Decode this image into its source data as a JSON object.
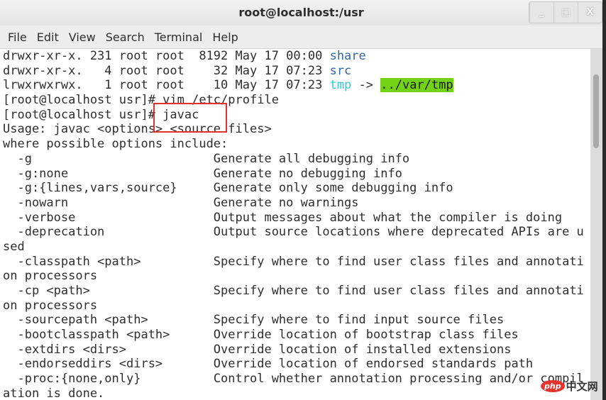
{
  "window": {
    "title": "root@localhost:/usr",
    "controls": [
      "minimize",
      "maximize",
      "close"
    ]
  },
  "menubar": [
    "File",
    "Edit",
    "View",
    "Search",
    "Terminal",
    "Help"
  ],
  "lines": [
    [
      {
        "t": "drwxr-xr-x. 231 root root  8192 May 17 00:00 "
      },
      {
        "t": "share",
        "c": "blue"
      }
    ],
    [
      {
        "t": "drwxr-xr-x.   4 root root    32 May 17 07:23 "
      },
      {
        "t": "src",
        "c": "blue"
      }
    ],
    [
      {
        "t": "lrwxrwxrwx.   1 root root    10 May 17 07:23 "
      },
      {
        "t": "tmp",
        "c": "cyan"
      },
      {
        "t": " -> "
      },
      {
        "t": "../var/tmp",
        "c": "hl"
      }
    ],
    [
      {
        "t": "[root@localhost usr]# vim /etc/profile"
      }
    ],
    [
      {
        "t": "[root@localhost usr]# javac"
      }
    ],
    [
      {
        "t": "Usage: javac <options> <source files>"
      }
    ],
    [
      {
        "t": "where possible options include:"
      }
    ],
    [
      {
        "t": "  -g                         Generate all debugging info"
      }
    ],
    [
      {
        "t": "  -g:none                    Generate no debugging info"
      }
    ],
    [
      {
        "t": "  -g:{lines,vars,source}     Generate only some debugging info"
      }
    ],
    [
      {
        "t": "  -nowarn                    Generate no warnings"
      }
    ],
    [
      {
        "t": "  -verbose                   Output messages about what the compiler is doing"
      }
    ],
    [
      {
        "t": "  -deprecation               Output source locations where deprecated APIs are u"
      }
    ],
    [
      {
        "t": "sed"
      }
    ],
    [
      {
        "t": "  -classpath <path>          Specify where to find user class files and annotati"
      }
    ],
    [
      {
        "t": "on processors"
      }
    ],
    [
      {
        "t": "  -cp <path>                 Specify where to find user class files and annotati"
      }
    ],
    [
      {
        "t": "on processors"
      }
    ],
    [
      {
        "t": "  -sourcepath <path>         Specify where to find input source files"
      }
    ],
    [
      {
        "t": "  -bootclasspath <path>      Override location of bootstrap class files"
      }
    ],
    [
      {
        "t": "  -extdirs <dirs>            Override location of installed extensions"
      }
    ],
    [
      {
        "t": "  -endorseddirs <dirs>       Override location of endorsed standards path"
      }
    ],
    [
      {
        "t": "  -proc:{none,only}          Control whether annotation processing and/or compil"
      }
    ],
    [
      {
        "t": "ation is done."
      }
    ]
  ],
  "highlight_color": "#e03030",
  "watermark": {
    "logo": "php",
    "text": "中文网"
  }
}
